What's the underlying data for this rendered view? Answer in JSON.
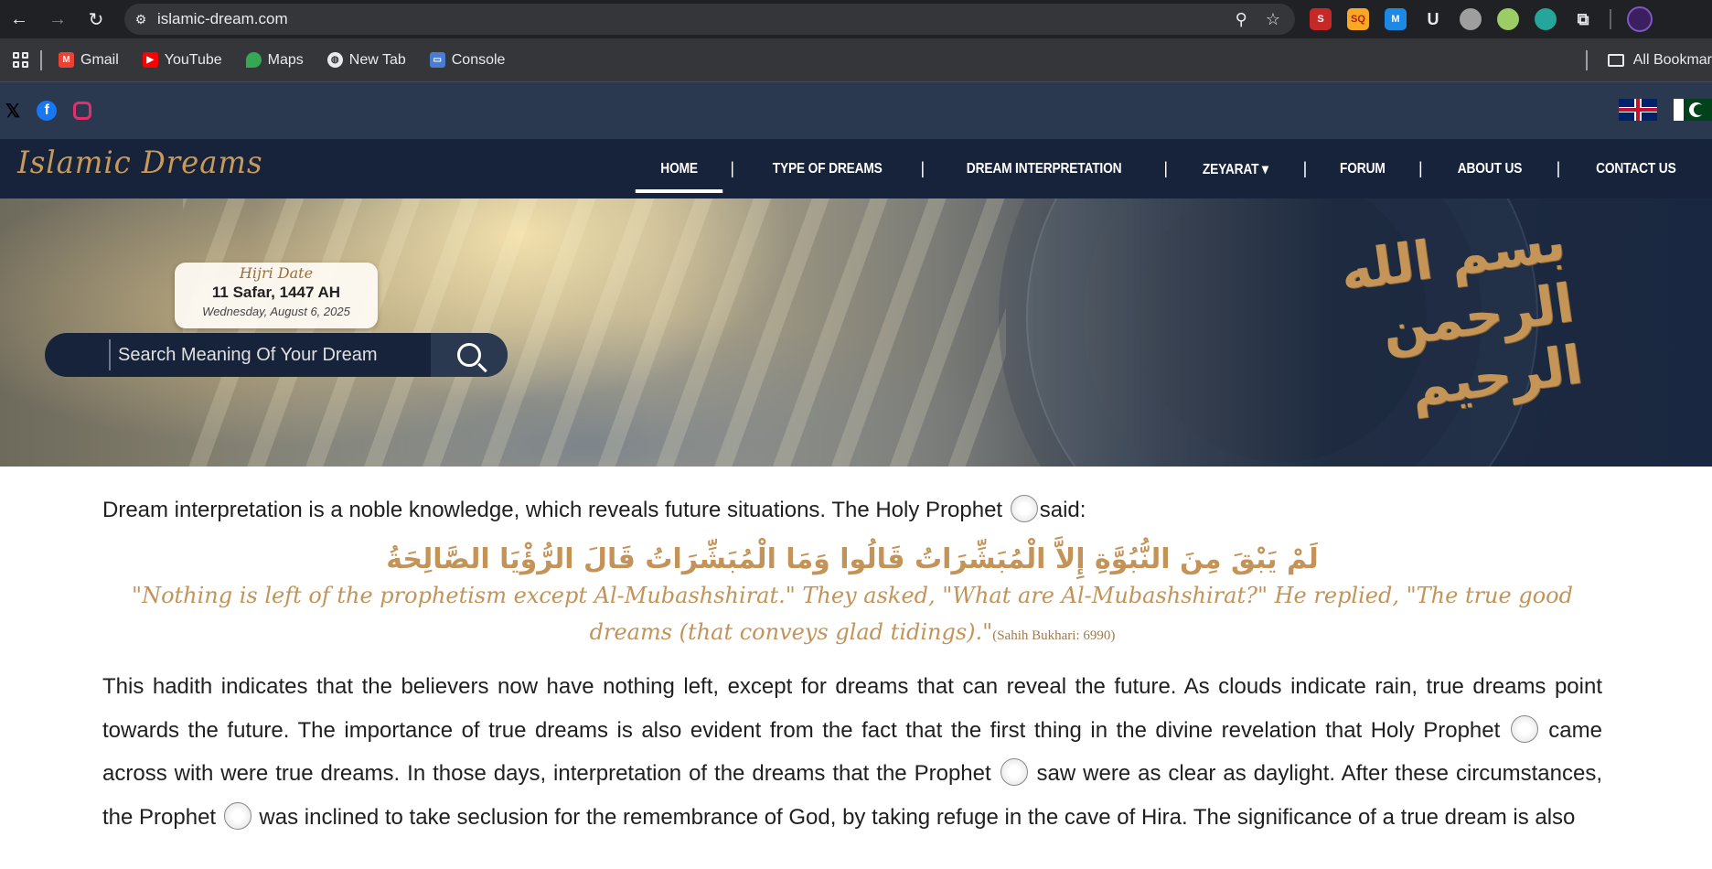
{
  "browser": {
    "url": "islamic-dream.com",
    "bookmarks": [
      {
        "label": "Gmail",
        "icon": "gmail-icon",
        "color": "#ea4335"
      },
      {
        "label": "YouTube",
        "icon": "youtube-icon",
        "color": "#ff0000"
      },
      {
        "label": "Maps",
        "icon": "maps-icon",
        "color": "#34a853"
      },
      {
        "label": "New Tab",
        "icon": "globe-icon",
        "color": "#5f6368"
      },
      {
        "label": "Console",
        "icon": "console-icon",
        "color": "#4a7ccf"
      }
    ],
    "all_bookmarks_label": "All Bookmar"
  },
  "site": {
    "logo": "Islamic Dreams",
    "menu": [
      {
        "label": "HOME",
        "active": true
      },
      {
        "label": "TYPE OF DREAMS"
      },
      {
        "label": "DREAM INTERPRETATION"
      },
      {
        "label": "ZEYARAT ▾"
      },
      {
        "label": "FORUM"
      },
      {
        "label": "ABOUT US"
      },
      {
        "label": "CONTACT US"
      }
    ],
    "hijri": {
      "title": "Hijri Date",
      "date": "11 Safar, 1447 AH",
      "gregorian": "Wednesday, August 6, 2025"
    },
    "search": {
      "placeholder": "Search Meaning Of Your Dream"
    },
    "hero_calligraphy": "بسم الله الرحمن الرحيم",
    "colors": {
      "accent": "#c39358",
      "nav": "#16233a",
      "topbar": "#2a3850"
    }
  },
  "content": {
    "intro_before": "Dream interpretation is a noble knowledge, which reveals future situations. The Holy Prophet ",
    "intro_after": "said:",
    "arabic": "لَمْ يَبْقَ مِنَ النُّبُوَّةِ إِلاَّ الْمُبَشِّرَاتُ قَالُوا وَمَا الْمُبَشِّرَاتُ قَالَ الرُّؤْيَا الصَّالِحَةُ",
    "quote": "\"Nothing is left of the prophetism except Al-Mubashshirat.\" They asked, \"What are Al-Mubashshirat?\" He replied, \"The true good dreams (that conveys glad tidings).\"",
    "quote_ref": "(Sahih Bukhari: 6990)",
    "para_1": "This hadith indicates that the believers now have nothing left, except for dreams that can reveal the future. As clouds indicate rain, true dreams point towards the future. The importance of true dreams is also evident from the fact that the first thing in the divine revelation that Holy Prophet ",
    "para_2": " came across with were true dreams. In those days, interpretation of the dreams that the Prophet ",
    "para_3": " saw were as clear as daylight. After these circumstances, the Prophet ",
    "para_4": " was inclined to take seclusion for the remembrance of God, by taking refuge in the cave of Hira. The significance of a true dream is also"
  }
}
